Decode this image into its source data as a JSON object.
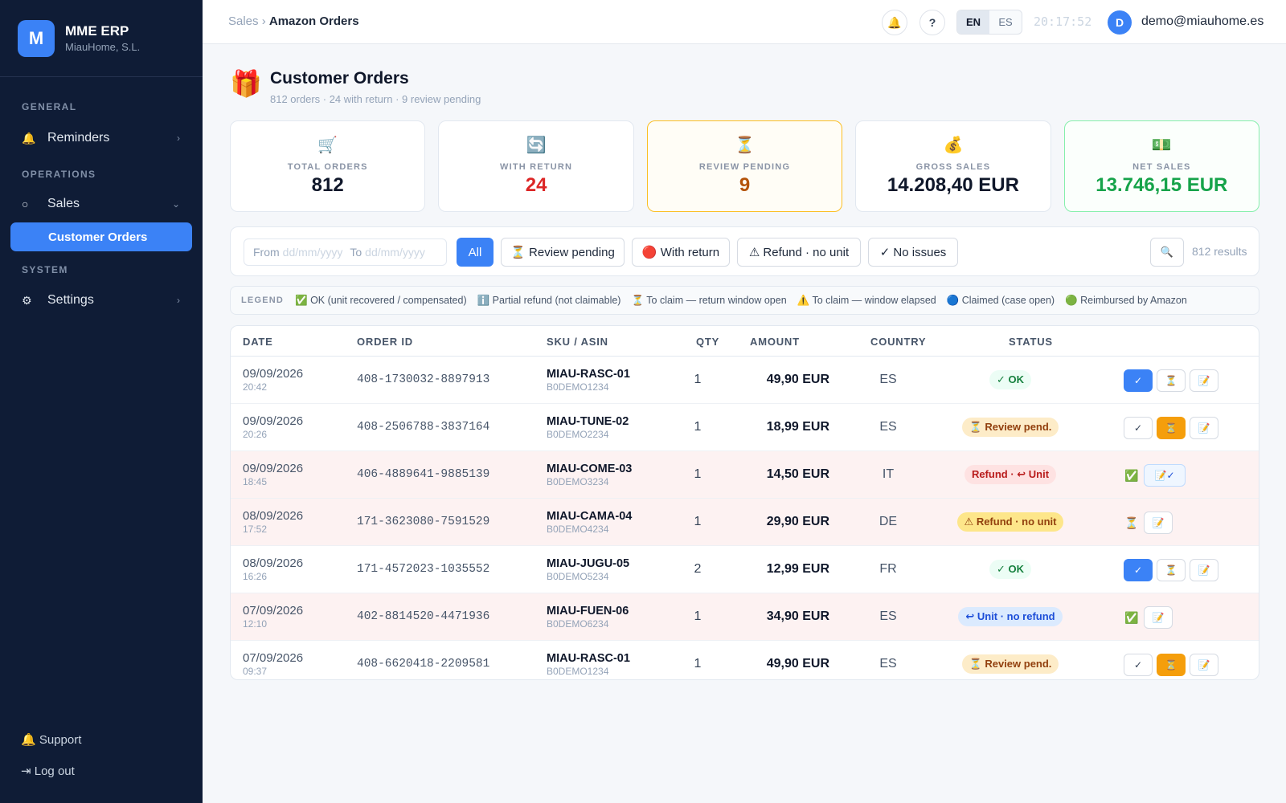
{
  "brand": {
    "logo_letter": "M",
    "name": "MME ERP",
    "company": "MiauHome, S.L."
  },
  "sidebar": {
    "sections": [
      {
        "title": "GENERAL"
      },
      {
        "title": "OPERATIONS"
      },
      {
        "title": "SYSTEM"
      }
    ],
    "items": [
      {
        "label": "Reminders",
        "icon": "bell-icon",
        "glyph": "🔔",
        "chevron": "›"
      },
      {
        "label": "Sales",
        "icon": "circle-icon",
        "glyph": "○",
        "chevron": "⌄"
      },
      {
        "label": "Customer Orders"
      },
      {
        "label": "Settings",
        "icon": "gear-icon",
        "glyph": "⚙",
        "chevron": "›"
      }
    ],
    "support": {
      "glyph": "🔔",
      "label": "Support"
    },
    "logout": {
      "glyph": "⇥",
      "label": "Log out"
    }
  },
  "topbar": {
    "breadcrumb": {
      "parent": "Sales",
      "separator": "›",
      "current": "Amazon Orders"
    },
    "bell": "🔔",
    "help": "?",
    "lang": {
      "en": "EN",
      "es": "ES",
      "active": "EN"
    },
    "clock": "20:17:52",
    "avatar_letter": "D",
    "user_email": "demo@miauhome.es"
  },
  "page": {
    "icon": "🎁",
    "title": "Customer Orders",
    "subtitle": "812 orders · 24 with return · 9 review pending"
  },
  "kpis": [
    {
      "icon": "🛒",
      "label": "TOTAL ORDERS",
      "value": "812"
    },
    {
      "icon": "🔄",
      "label": "WITH RETURN",
      "value": "24"
    },
    {
      "icon": "⏳",
      "label": "REVIEW PENDING",
      "value": "9"
    },
    {
      "icon": "💰",
      "label": "GROSS SALES",
      "value": "14.208,40 EUR"
    },
    {
      "icon": "💵",
      "label": "NET SALES",
      "value": "13.746,15 EUR"
    }
  ],
  "filters": {
    "date": {
      "from_label": "From",
      "from_placeholder": "dd/mm/yyyy",
      "to_label": "To",
      "to_placeholder": "dd/mm/yyyy"
    },
    "buttons": [
      {
        "label": "All",
        "active": true
      },
      {
        "label": "⏳ Review pending"
      },
      {
        "label": "🔴 With return"
      },
      {
        "label": "⚠ Refund · no unit"
      },
      {
        "label": "✓ No issues"
      }
    ],
    "search_glyph": "🔍",
    "results": "812 results"
  },
  "legend": {
    "title": "LEGEND",
    "items": [
      "✅ OK (unit recovered / compensated)",
      "ℹ️ Partial refund (not claimable)",
      "⏳ To claim — return window open",
      "⚠️ To claim — window elapsed",
      "🔵 Claimed (case open)",
      "🟢 Reimbursed by Amazon"
    ]
  },
  "table": {
    "columns": [
      "DATE",
      "ORDER ID",
      "SKU / ASIN",
      "QTY",
      "AMOUNT",
      "COUNTRY",
      "STATUS"
    ],
    "rows": [
      {
        "date": "09/09/2026",
        "time": "20:42",
        "order_id": "408-1730032-8897913",
        "sku": "MIAU-RASC-01",
        "asin": "B0DEMO1234",
        "qty": "1",
        "amount": "49,90 EUR",
        "country": "ES",
        "status": "✓ OK",
        "actions": {
          "b1": "✓",
          "b2": "⏳",
          "b3": "📝"
        }
      },
      {
        "date": "09/09/2026",
        "time": "20:26",
        "order_id": "408-2506788-3837164",
        "sku": "MIAU-TUNE-02",
        "asin": "B0DEMO2234",
        "qty": "1",
        "amount": "18,99 EUR",
        "country": "ES",
        "status": "⏳ Review pend.",
        "actions": {
          "b1": "✓",
          "b2": "⏳",
          "b3": "📝"
        }
      },
      {
        "date": "09/09/2026",
        "time": "18:45",
        "order_id": "406-4889641-9885139",
        "sku": "MIAU-COME-03",
        "asin": "B0DEMO3234",
        "qty": "1",
        "amount": "14,50 EUR",
        "country": "IT",
        "status": "Refund · ↩ Unit",
        "actions": {
          "g": "✅",
          "b": "📝✓"
        }
      },
      {
        "date": "08/09/2026",
        "time": "17:52",
        "order_id": "171-3623080-7591529",
        "sku": "MIAU-CAMA-04",
        "asin": "B0DEMO4234",
        "qty": "1",
        "amount": "29,90 EUR",
        "country": "DE",
        "status": "⚠ Refund · no unit",
        "actions": {
          "g": "⏳",
          "b": "📝"
        }
      },
      {
        "date": "08/09/2026",
        "time": "16:26",
        "order_id": "171-4572023-1035552",
        "sku": "MIAU-JUGU-05",
        "asin": "B0DEMO5234",
        "qty": "2",
        "amount": "12,99 EUR",
        "country": "FR",
        "status": "✓ OK",
        "actions": {
          "b1": "✓",
          "b2": "⏳",
          "b3": "📝"
        }
      },
      {
        "date": "07/09/2026",
        "time": "12:10",
        "order_id": "402-8814520-4471936",
        "sku": "MIAU-FUEN-06",
        "asin": "B0DEMO6234",
        "qty": "1",
        "amount": "34,90 EUR",
        "country": "ES",
        "status": "↩ Unit · no refund",
        "actions": {
          "g": "✅",
          "b": "📝"
        }
      },
      {
        "date": "07/09/2026",
        "time": "09:37",
        "order_id": "408-6620418-2209581",
        "sku": "MIAU-RASC-01",
        "asin": "B0DEMO1234",
        "qty": "1",
        "amount": "49,90 EUR",
        "country": "ES",
        "status": "⏳ Review pend.",
        "actions": {
          "b1": "✓",
          "b2": "⏳",
          "b3": "📝"
        }
      }
    ]
  },
  "colors": {
    "sidebar_bg": "#0f1c36",
    "accent": "#3b82f6",
    "warn": "#f59e0b",
    "danger": "#dc2626",
    "success": "#16a34a"
  }
}
